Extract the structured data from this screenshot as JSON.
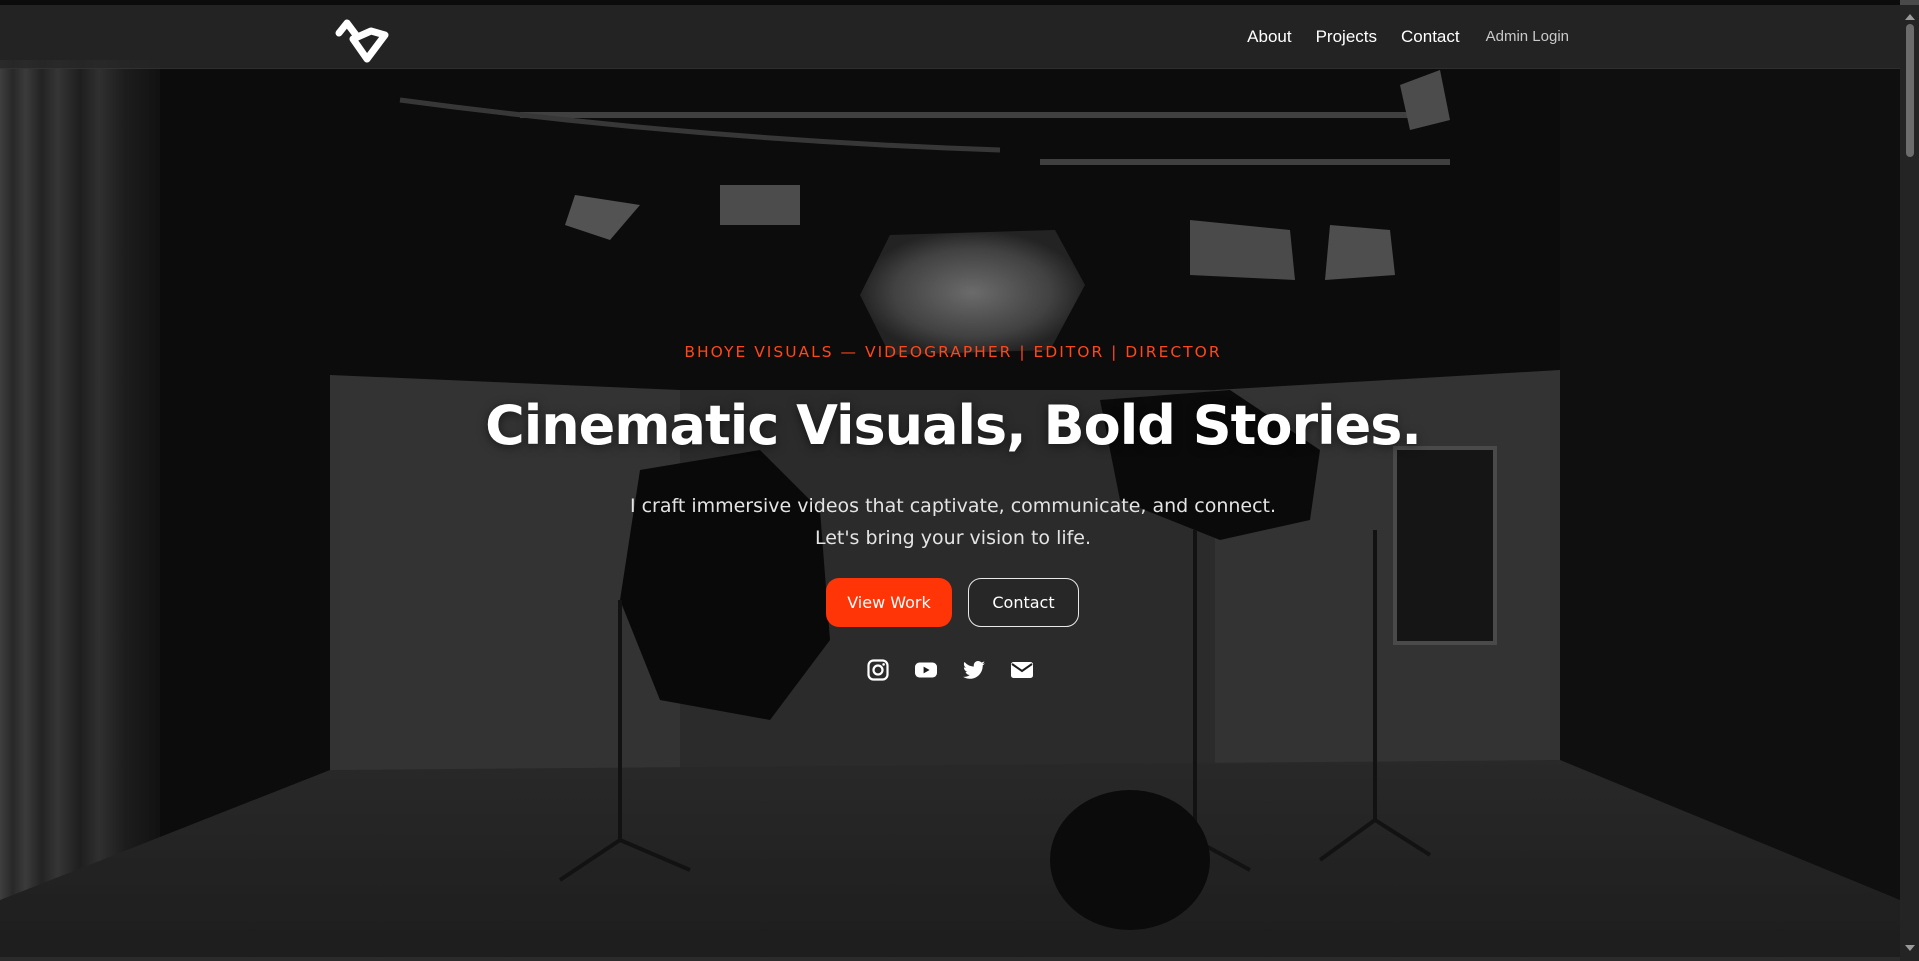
{
  "brand": {
    "logo_icon": "stylized-v-logo-icon"
  },
  "nav": {
    "links": [
      {
        "label": "About"
      },
      {
        "label": "Projects"
      },
      {
        "label": "Contact"
      }
    ],
    "admin_label": "Admin Login"
  },
  "hero": {
    "tagline": "BHOYE VISUALS — VIDEOGRAPHER | EDITOR | DIRECTOR",
    "headline": "Cinematic Visuals, Bold Stories.",
    "subtitle": "I craft immersive videos that captivate, communicate, and connect. Let's bring your vision to life.",
    "primary_button": "View Work",
    "secondary_button": "Contact",
    "background": "photo-studio-lighting-scene"
  },
  "socials": [
    {
      "icon": "instagram-icon"
    },
    {
      "icon": "youtube-icon"
    },
    {
      "icon": "twitter-icon"
    },
    {
      "icon": "email-icon"
    }
  ],
  "colors": {
    "accent": "#ff3407",
    "tagline": "#ff4719",
    "nav_bg": "#2c2c2c",
    "text": "#ffffff"
  }
}
